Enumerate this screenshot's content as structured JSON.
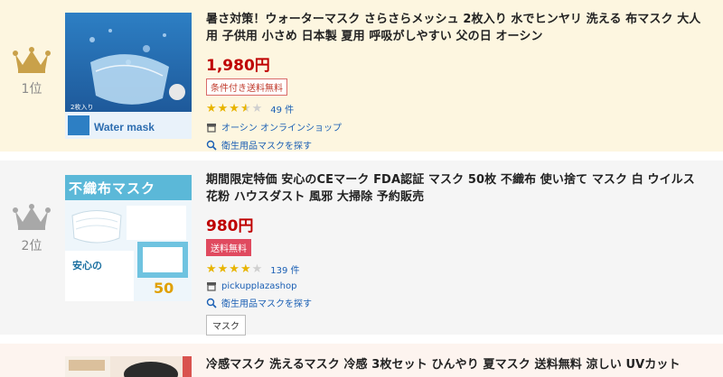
{
  "items": [
    {
      "rank": "1位",
      "title": "暑さ対策！ウォーターマスク さらさらメッシュ 2枚入り 水でヒンヤリ 洗える 布マスク 大人用 子供用 小さめ 日本製 夏用 呼吸がしやすい 父の日 オーシン",
      "price": "1,980円",
      "shipping": "条件付き送料無料",
      "rating": 3.5,
      "review_count": "49 件",
      "shop": "オーシン オンラインショップ",
      "search_link": "衛生用品マスクを探す",
      "thumb_text": "Water mask",
      "thumb_sub": "2枚入り"
    },
    {
      "rank": "2位",
      "title": "期間限定特価 安心のCEマーク FDA認証 マスク 50枚 不織布 使い捨て マスク 白 ウイルス 花粉 ハウスダスト 風邪 大掃除 予約販売",
      "price": "980円",
      "shipping": "送料無料",
      "rating": 4,
      "review_count": "139 件",
      "shop": "pickupplazashop",
      "search_link": "衛生用品マスクを探す",
      "tag": "マスク",
      "thumb_text": "不織布マスク",
      "thumb_sub": "安心の",
      "thumb_count": "50"
    },
    {
      "title": "冷感マスク 洗えるマスク 冷感 3枚セット ひんやり 夏マスク 送料無料 涼しい UVカット"
    }
  ],
  "colors": {
    "gold": "#c9a14a",
    "silver": "#a8a8a8",
    "price": "#bf0000",
    "link": "#1a5fb4"
  }
}
